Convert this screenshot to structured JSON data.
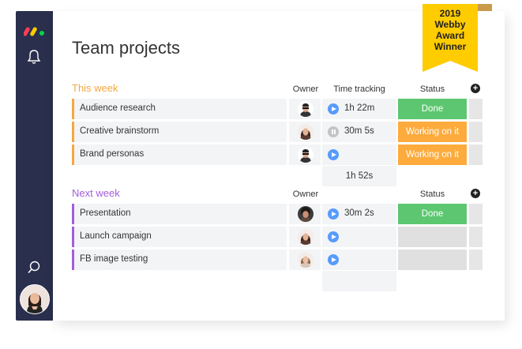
{
  "page": {
    "title": "Team projects"
  },
  "badge": {
    "lines": [
      "2019",
      "Webby",
      "Award",
      "Winner"
    ]
  },
  "columns": {
    "owner": "Owner",
    "time": "Time tracking",
    "status": "Status"
  },
  "groups": [
    {
      "title": "This week",
      "color": "#f4a742",
      "rows": [
        {
          "name": "Audience research",
          "owner": "man-sunglasses",
          "timer": "play",
          "time": "1h 22m",
          "status": "Done",
          "status_color": "#5cc770"
        },
        {
          "name": "Creative brainstorm",
          "owner": "woman-dark-hair",
          "timer": "pause",
          "time": "30m 5s",
          "status": "Working on it",
          "status_color": "#fdab3d"
        },
        {
          "name": "Brand personas",
          "owner": "man-sunglasses",
          "timer": "play",
          "time": "",
          "status": "Working on it",
          "status_color": "#fdab3d"
        }
      ],
      "total_time": "1h 52s"
    },
    {
      "title": "Next week",
      "color": "#a25ddc",
      "rows": [
        {
          "name": "Presentation",
          "owner": "man-curly-hair",
          "timer": "play",
          "time": "30m 2s",
          "status": "Done",
          "status_color": "#5cc770"
        },
        {
          "name": "Launch campaign",
          "owner": "woman-dark-hair",
          "timer": "play",
          "time": "",
          "status": "",
          "status_color": "#e0e0e0"
        },
        {
          "name": "FB image testing",
          "owner": "woman-light-hair",
          "timer": "play",
          "time": "",
          "status": "",
          "status_color": "#e0e0e0"
        }
      ],
      "total_time": ""
    }
  ],
  "colors": {
    "sidebar": "#292f4c",
    "done": "#5cc770",
    "working": "#fdab3d",
    "play": "#579bfc"
  }
}
